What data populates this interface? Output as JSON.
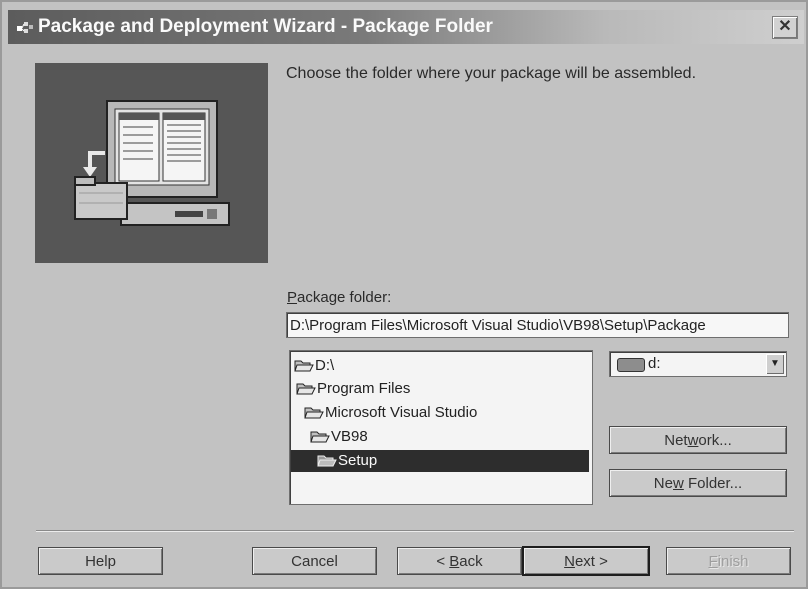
{
  "window": {
    "title": "Package and Deployment Wizard - Package Folder",
    "close_symbol": "✕"
  },
  "intro_text": "Choose the folder where your package will be assembled.",
  "package_folder": {
    "label_mnemonic": "P",
    "label_rest": "ackage folder:",
    "value": "D:\\Program Files\\Microsoft Visual Studio\\VB98\\Setup\\Package"
  },
  "folder_tree": {
    "items": [
      {
        "label": "D:\\",
        "icon": "open-folder-icon"
      },
      {
        "label": "Program Files",
        "icon": "open-folder-icon"
      },
      {
        "label": "Microsoft Visual Studio",
        "icon": "open-folder-icon"
      },
      {
        "label": "VB98",
        "icon": "open-folder-icon"
      },
      {
        "label": "Setup",
        "icon": "open-folder-icon",
        "selected": true
      }
    ]
  },
  "drive_select": {
    "value": "d:",
    "icon": "drive-icon"
  },
  "buttons": {
    "network_pre": "Net",
    "network_mn": "w",
    "network_post": "ork...",
    "newfolder_pre": "Ne",
    "newfolder_mn": "w",
    "newfolder_post": " Folder...",
    "help": "Help",
    "cancel": "Cancel",
    "back_pre": "< ",
    "back_mn": "B",
    "back_post": "ack",
    "next_mn": "N",
    "next_post": "ext >",
    "finish_mn": "F",
    "finish_post": "inish"
  },
  "colors": {
    "window_bg": "#c2c2c2",
    "selection_bg": "#2d2d2d",
    "illustration_bg": "#565656"
  }
}
